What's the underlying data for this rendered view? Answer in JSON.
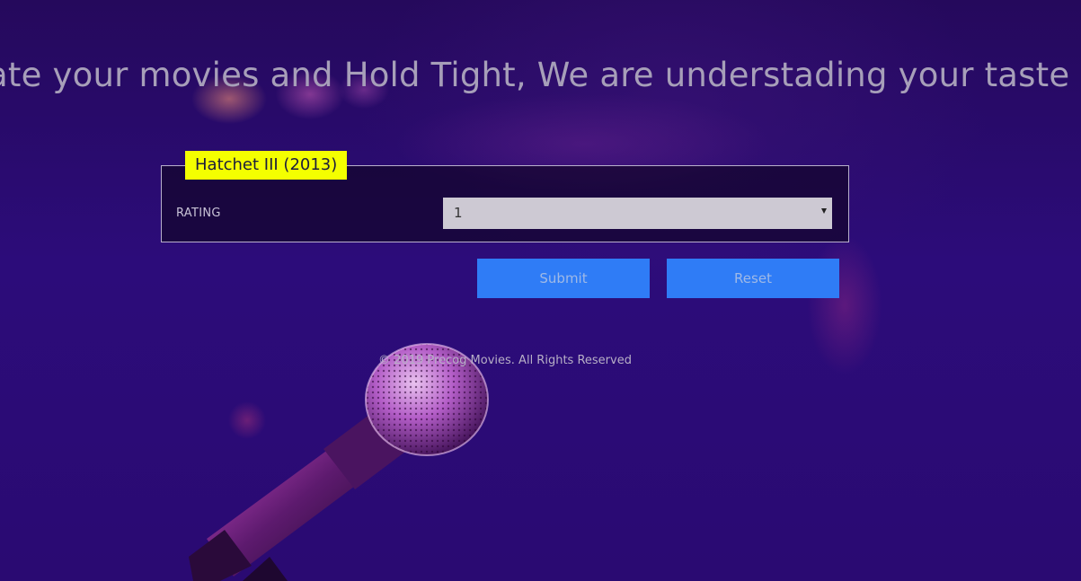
{
  "header": {
    "headline": "ate your movies and Hold Tight, We are understading your taste"
  },
  "rating_form": {
    "movie_title": "Hatchet III (2013)",
    "rating_label": "RATING",
    "rating_value": "1"
  },
  "actions": {
    "submit_label": "Submit",
    "reset_label": "Reset"
  },
  "footer": {
    "copyright": "© 2019 Precog Movies. All Rights Reserved"
  },
  "colors": {
    "background": "#2a0c6e",
    "title_highlight": "#f4ff00",
    "button": "#2f7cf6",
    "select": "#cdc9d3"
  },
  "icons": {
    "dropdown": "caret-down-icon",
    "background_image": "microphone-image"
  }
}
